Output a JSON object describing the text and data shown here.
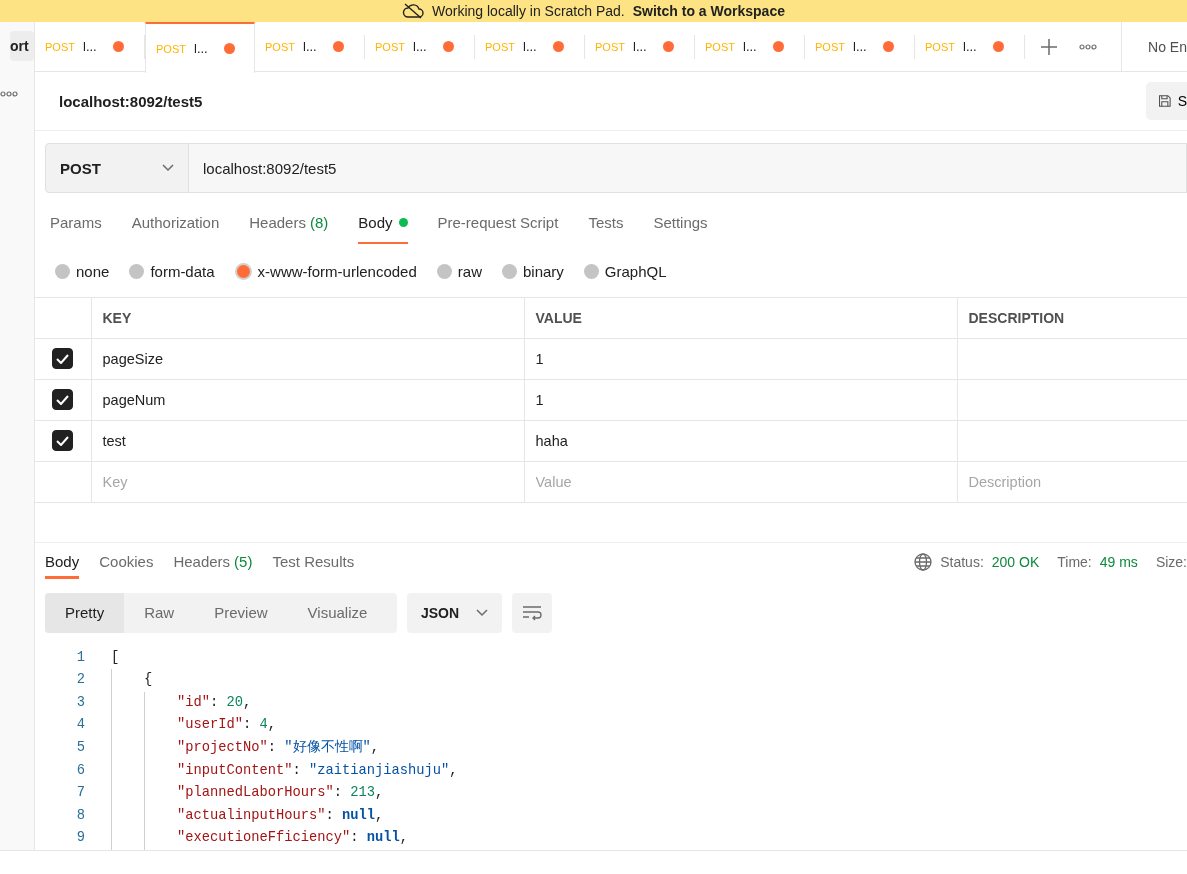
{
  "banner": {
    "text": "Working locally in Scratch Pad.",
    "link": "Switch to a Workspace"
  },
  "sidebar": {
    "button": "ort"
  },
  "tabs": [
    {
      "method": "POST",
      "name": "l...",
      "selected": false,
      "unsaved": true
    },
    {
      "method": "POST",
      "name": "l...",
      "selected": true,
      "unsaved": true
    },
    {
      "method": "POST",
      "name": "l...",
      "selected": false,
      "unsaved": true
    },
    {
      "method": "POST",
      "name": "l...",
      "selected": false,
      "unsaved": true
    },
    {
      "method": "POST",
      "name": "l...",
      "selected": false,
      "unsaved": true
    },
    {
      "method": "POST",
      "name": "l...",
      "selected": false,
      "unsaved": true
    },
    {
      "method": "POST",
      "name": "l...",
      "selected": false,
      "unsaved": true
    },
    {
      "method": "POST",
      "name": "l...",
      "selected": false,
      "unsaved": true
    },
    {
      "method": "POST",
      "name": "l...",
      "selected": false,
      "unsaved": true
    }
  ],
  "environment": "No En",
  "request": {
    "title": "localhost:8092/test5",
    "save": "S",
    "method": "POST",
    "url": "localhost:8092/test5"
  },
  "request_tabs": [
    {
      "label": "Params",
      "selected": false,
      "has_content": false
    },
    {
      "label": "Authorization",
      "selected": false,
      "has_content": false
    },
    {
      "label": "Headers",
      "count": "(8)",
      "selected": false,
      "has_content": false
    },
    {
      "label": "Body",
      "selected": true,
      "has_content": true
    },
    {
      "label": "Pre-request Script",
      "selected": false,
      "has_content": false
    },
    {
      "label": "Tests",
      "selected": false,
      "has_content": false
    },
    {
      "label": "Settings",
      "selected": false,
      "has_content": false
    }
  ],
  "body_types": [
    {
      "label": "none",
      "selected": false
    },
    {
      "label": "form-data",
      "selected": false
    },
    {
      "label": "x-www-form-urlencoded",
      "selected": true
    },
    {
      "label": "raw",
      "selected": false
    },
    {
      "label": "binary",
      "selected": false
    },
    {
      "label": "GraphQL",
      "selected": false
    }
  ],
  "params": {
    "columns": [
      "KEY",
      "VALUE",
      "DESCRIPTION"
    ],
    "rows": [
      {
        "checked": true,
        "key": "pageSize",
        "value": "1"
      },
      {
        "checked": true,
        "key": "pageNum",
        "value": "1"
      },
      {
        "checked": true,
        "key": "test",
        "value": "haha"
      }
    ],
    "empty_row": [
      {
        "placeholder": "Key"
      },
      {
        "placeholder": "Value"
      },
      {
        "placeholder": "Description"
      }
    ]
  },
  "response": {
    "tabs": [
      {
        "label": "Body",
        "selected": true
      },
      {
        "label": "Cookies",
        "selected": false
      },
      {
        "label": "Headers",
        "count": "(5)",
        "selected": false
      },
      {
        "label": "Test Results",
        "selected": false
      }
    ],
    "status_label": "Status:",
    "status": "200 OK",
    "time_label": "Time:",
    "time": "49 ms",
    "size_label": "Size:",
    "views": [
      {
        "label": "Pretty",
        "selected": true
      },
      {
        "label": "Raw",
        "selected": false
      },
      {
        "label": "Preview",
        "selected": false
      },
      {
        "label": "Visualize",
        "selected": false
      }
    ],
    "format": "JSON",
    "lines": [
      {
        "number": "1",
        "tokens": [
          {
            "kind": "punct",
            "text": "["
          }
        ]
      },
      {
        "number": "2",
        "tokens": [
          {
            "kind": "punct",
            "text": "    {"
          }
        ]
      },
      {
        "number": "3",
        "tokens": [
          {
            "kind": "key",
            "text": "        \"id\""
          },
          {
            "kind": "punct",
            "text": ": "
          },
          {
            "kind": "number",
            "text": "20"
          },
          {
            "kind": "punct",
            "text": ","
          }
        ]
      },
      {
        "number": "4",
        "tokens": [
          {
            "kind": "key",
            "text": "        \"userId\""
          },
          {
            "kind": "punct",
            "text": ": "
          },
          {
            "kind": "number",
            "text": "4"
          },
          {
            "kind": "punct",
            "text": ","
          }
        ]
      },
      {
        "number": "5",
        "tokens": [
          {
            "kind": "key",
            "text": "        \"projectNo\""
          },
          {
            "kind": "punct",
            "text": ": "
          },
          {
            "kind": "string",
            "text": "\"好像不性啊\""
          },
          {
            "kind": "punct",
            "text": ","
          }
        ]
      },
      {
        "number": "6",
        "tokens": [
          {
            "kind": "key",
            "text": "        \"inputContent\""
          },
          {
            "kind": "punct",
            "text": ": "
          },
          {
            "kind": "string",
            "text": "\"zaitianjiashuju\""
          },
          {
            "kind": "punct",
            "text": ","
          }
        ]
      },
      {
        "number": "7",
        "tokens": [
          {
            "kind": "key",
            "text": "        \"plannedLaborHours\""
          },
          {
            "kind": "punct",
            "text": ": "
          },
          {
            "kind": "number",
            "text": "213"
          },
          {
            "kind": "punct",
            "text": ","
          }
        ]
      },
      {
        "number": "8",
        "tokens": [
          {
            "kind": "key",
            "text": "        \"actualinputHours\""
          },
          {
            "kind": "punct",
            "text": ": "
          },
          {
            "kind": "null",
            "text": "null"
          },
          {
            "kind": "punct",
            "text": ","
          }
        ]
      },
      {
        "number": "9",
        "tokens": [
          {
            "kind": "key",
            "text": "        \"executioneFficiency\""
          },
          {
            "kind": "punct",
            "text": ": "
          },
          {
            "kind": "null",
            "text": "null"
          },
          {
            "kind": "punct",
            "text": ","
          }
        ]
      }
    ]
  }
}
